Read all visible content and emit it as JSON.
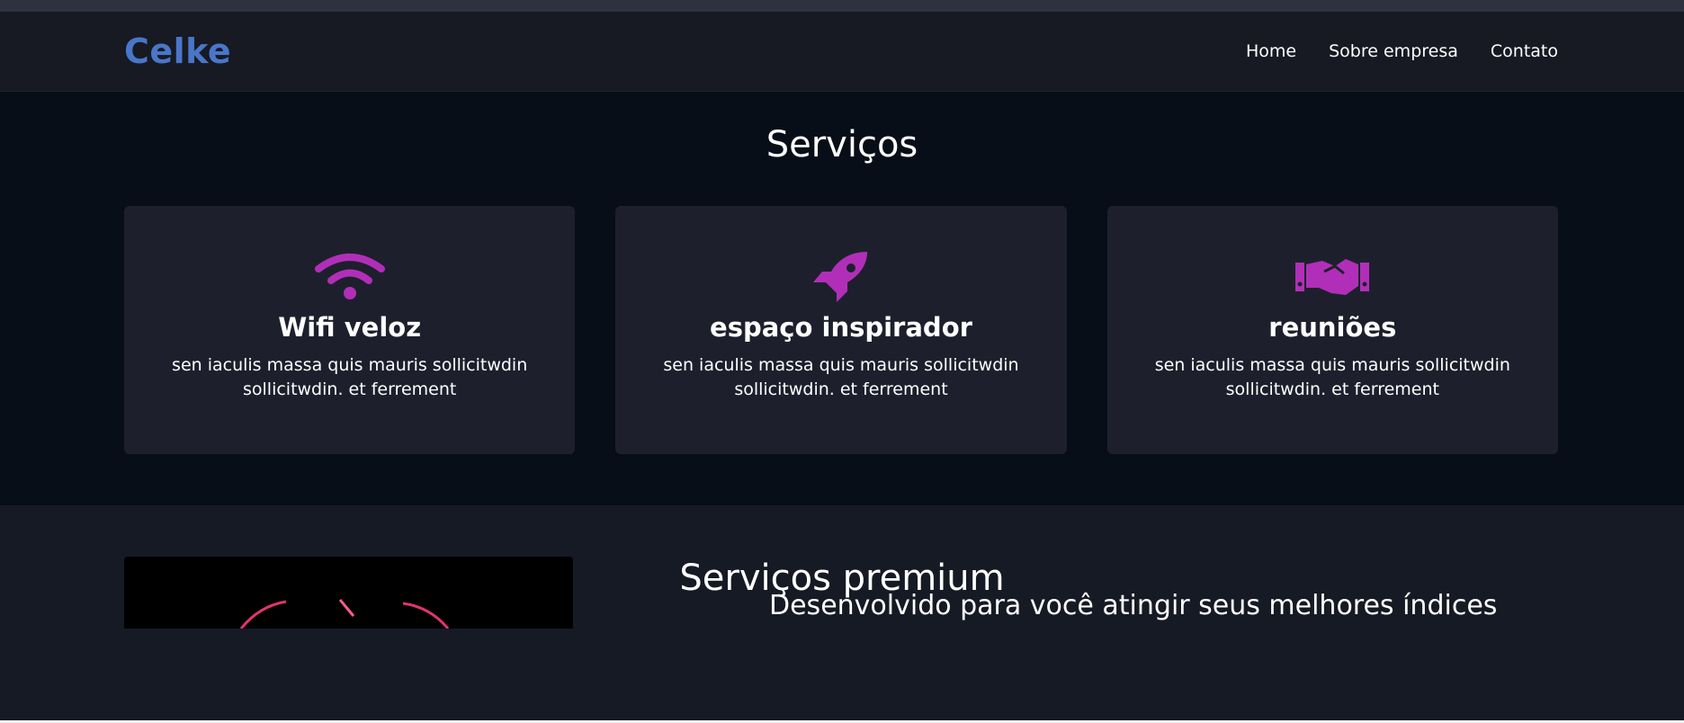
{
  "brand": {
    "logo": "Celke",
    "color": "#4a76c9"
  },
  "nav": {
    "items": [
      {
        "label": "Home"
      },
      {
        "label": "Sobre empresa"
      },
      {
        "label": "Contato"
      }
    ]
  },
  "services": {
    "title": "Serviços",
    "icon_color": "#b12fb8",
    "cards": [
      {
        "icon": "wifi-icon",
        "title": "Wifi veloz",
        "desc": "sen iaculis massa quis mauris sollicitwdin sollicitwdin. et ferrement"
      },
      {
        "icon": "rocket-icon",
        "title": "espaço inspirador",
        "desc": "sen iaculis massa quis mauris sollicitwdin sollicitwdin. et ferrement"
      },
      {
        "icon": "handshake-icon",
        "title": "reuniões",
        "desc": "sen iaculis massa quis mauris sollicitwdin sollicitwdin. et ferrement"
      }
    ]
  },
  "premium": {
    "title": "Serviços premium",
    "heading": "Desenvolvido para você atingir seus melhores índices"
  }
}
